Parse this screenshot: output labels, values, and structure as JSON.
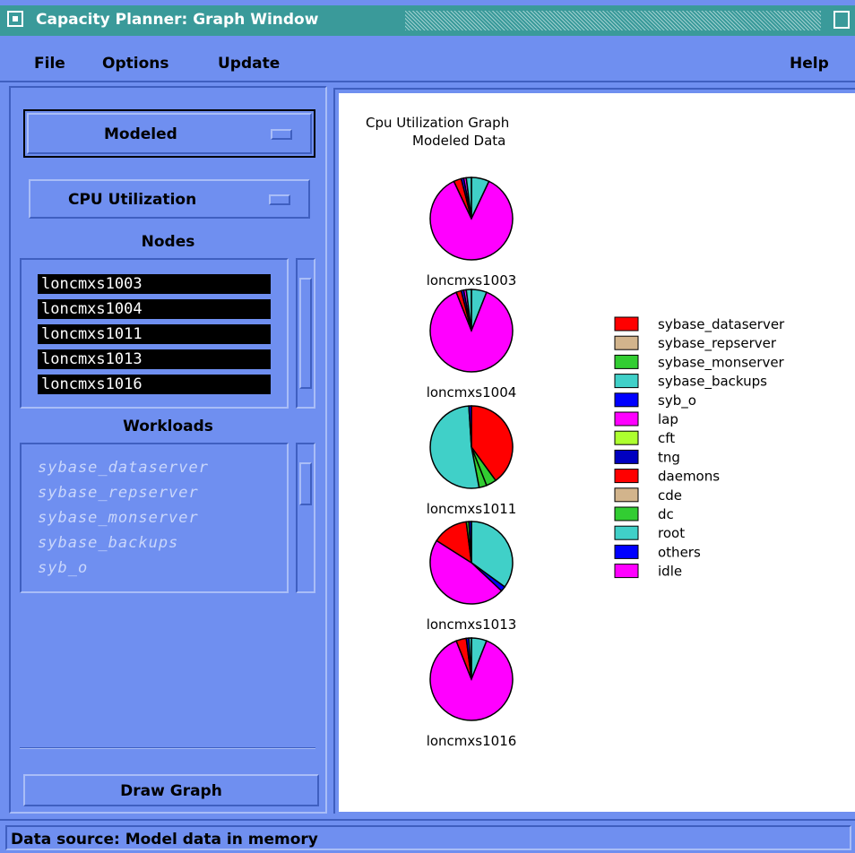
{
  "window": {
    "title": "Capacity Planner: Graph Window"
  },
  "menubar": {
    "file": "File",
    "options": "Options",
    "update": "Update",
    "help": "Help"
  },
  "controls": {
    "data_mode": "Modeled",
    "metric": "CPU Utilization",
    "nodes_heading": "Nodes",
    "nodes": [
      "loncmxs1003",
      "loncmxs1004",
      "loncmxs1011",
      "loncmxs1013",
      "loncmxs1016"
    ],
    "workloads_heading": "Workloads",
    "workloads": [
      "sybase_dataserver",
      "sybase_repserver",
      "sybase_monserver",
      "sybase_backups",
      "syb_o"
    ],
    "draw_button": "Draw Graph"
  },
  "graph": {
    "title_line1": "Cpu Utilization Graph",
    "title_line2": "Modeled Data"
  },
  "chart_data": {
    "type": "pie",
    "title": "Cpu Utilization Graph",
    "subtitle": "Modeled Data",
    "legend_position": "right",
    "legend": [
      {
        "name": "sybase_dataserver",
        "color": "#ff0000"
      },
      {
        "name": "sybase_repserver",
        "color": "#d2b48c"
      },
      {
        "name": "sybase_monserver",
        "color": "#32cd32"
      },
      {
        "name": "sybase_backups",
        "color": "#40d0c8"
      },
      {
        "name": "syb_o",
        "color": "#0000ff"
      },
      {
        "name": "lap",
        "color": "#ff00ff"
      },
      {
        "name": "cft",
        "color": "#adff2f"
      },
      {
        "name": "tng",
        "color": "#0000c0"
      },
      {
        "name": "daemons",
        "color": "#ff0000"
      },
      {
        "name": "cde",
        "color": "#d2b48c"
      },
      {
        "name": "dc",
        "color": "#32cd32"
      },
      {
        "name": "root",
        "color": "#40d0c8"
      },
      {
        "name": "others",
        "color": "#0000ff"
      },
      {
        "name": "idle",
        "color": "#ff00ff"
      }
    ],
    "pies": [
      {
        "node": "loncmxs1003",
        "slices": [
          {
            "name": "sybase_backups",
            "value": 7
          },
          {
            "name": "idle",
            "value": 86
          },
          {
            "name": "daemons",
            "value": 3
          },
          {
            "name": "others",
            "value": 1
          },
          {
            "name": "lap",
            "value": 1
          },
          {
            "name": "root",
            "value": 2
          }
        ]
      },
      {
        "node": "loncmxs1004",
        "slices": [
          {
            "name": "sybase_backups",
            "value": 6
          },
          {
            "name": "idle",
            "value": 88
          },
          {
            "name": "daemons",
            "value": 2
          },
          {
            "name": "others",
            "value": 1
          },
          {
            "name": "lap",
            "value": 1
          },
          {
            "name": "root",
            "value": 2
          }
        ]
      },
      {
        "node": "loncmxs1011",
        "slices": [
          {
            "name": "daemons",
            "value": 40
          },
          {
            "name": "dc",
            "value": 4
          },
          {
            "name": "sybase_monserver",
            "value": 3
          },
          {
            "name": "root",
            "value": 52
          },
          {
            "name": "others",
            "value": 1
          }
        ]
      },
      {
        "node": "loncmxs1013",
        "slices": [
          {
            "name": "root",
            "value": 35
          },
          {
            "name": "others",
            "value": 2
          },
          {
            "name": "idle",
            "value": 47
          },
          {
            "name": "daemons",
            "value": 14
          },
          {
            "name": "sybase_monserver",
            "value": 1
          },
          {
            "name": "tng",
            "value": 1
          }
        ]
      },
      {
        "node": "loncmxs1016",
        "slices": [
          {
            "name": "sybase_backups",
            "value": 6
          },
          {
            "name": "idle",
            "value": 88
          },
          {
            "name": "daemons",
            "value": 4
          },
          {
            "name": "others",
            "value": 1
          },
          {
            "name": "root",
            "value": 1
          }
        ]
      }
    ]
  },
  "status": {
    "text": "Data source: Model data in memory"
  }
}
